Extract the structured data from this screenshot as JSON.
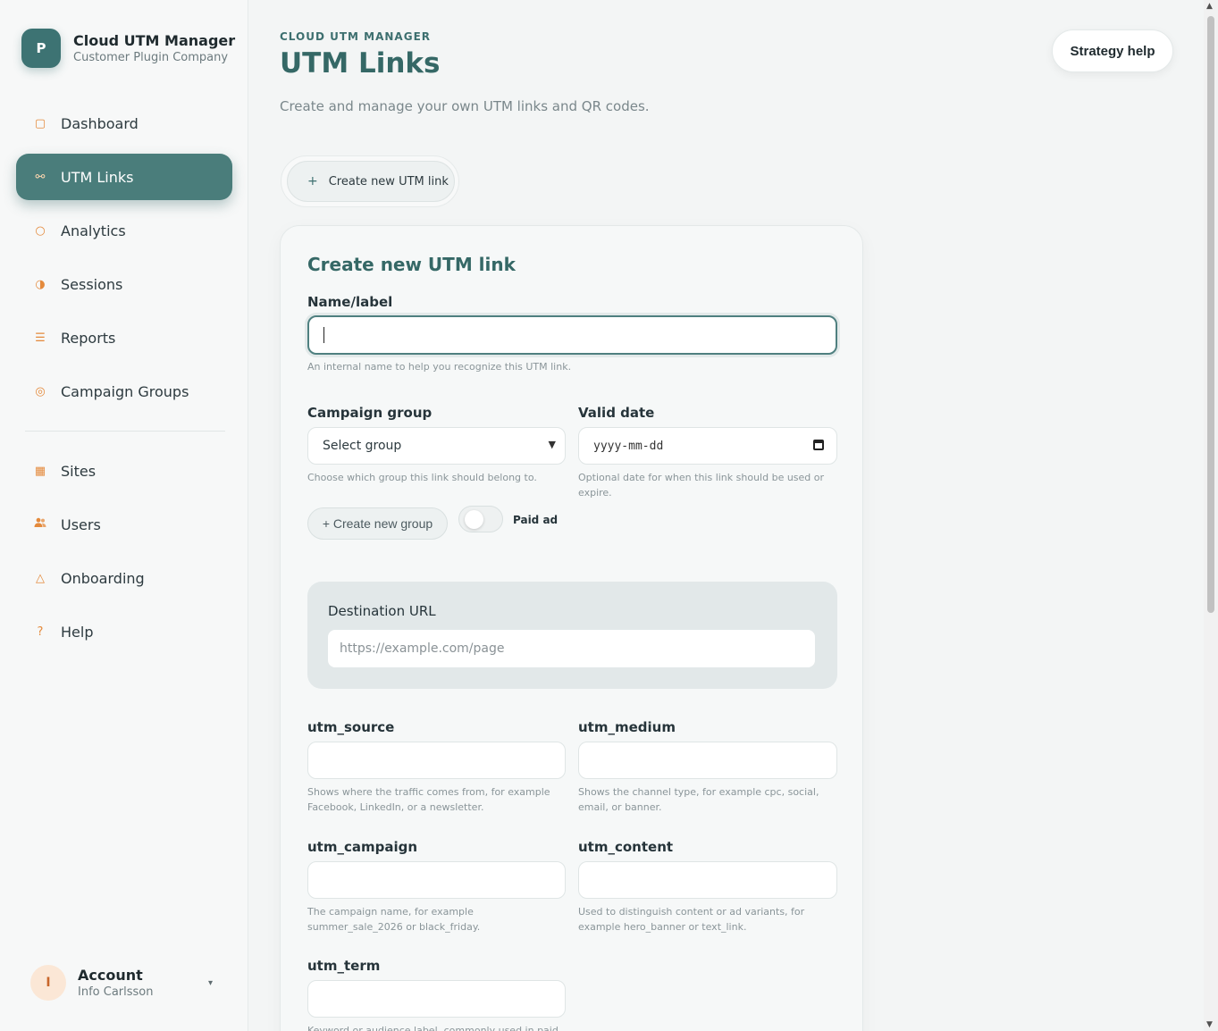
{
  "brand": {
    "logo_letter": "P",
    "title": "Cloud UTM Manager",
    "subtitle": "Customer Plugin Company"
  },
  "sidebar": {
    "items": [
      {
        "label": "Dashboard",
        "icon": "square-outline-icon",
        "glyph": "▢"
      },
      {
        "label": "UTM Links",
        "icon": "link-icon",
        "glyph": "⚯"
      },
      {
        "label": "Analytics",
        "icon": "circle-outline-icon",
        "glyph": "○"
      },
      {
        "label": "Sessions",
        "icon": "half-circle-icon",
        "glyph": "◑"
      },
      {
        "label": "Reports",
        "icon": "list-icon",
        "glyph": "☰"
      },
      {
        "label": "Campaign Groups",
        "icon": "target-icon",
        "glyph": "◎"
      },
      {
        "label": "Sites",
        "icon": "grid-icon",
        "glyph": "▦"
      },
      {
        "label": "Users",
        "icon": "users-icon",
        "glyph": "👥"
      },
      {
        "label": "Onboarding",
        "icon": "triangle-icon",
        "glyph": "△"
      },
      {
        "label": "Help",
        "icon": "question-icon",
        "glyph": "?"
      }
    ],
    "active": "UTM Links"
  },
  "account": {
    "initial": "I",
    "title": "Account",
    "subtitle": "Info Carlsson",
    "caret": "▾"
  },
  "header": {
    "eyebrow": "CLOUD UTM MANAGER",
    "title": "UTM Links",
    "description": "Create and manage your own UTM links and QR codes.",
    "help_label": "Strategy help"
  },
  "create_button": {
    "plus": "+",
    "label": "Create new UTM link"
  },
  "form": {
    "title": "Create new UTM link",
    "name": {
      "label": "Name/label",
      "value": "",
      "hint": "An internal name to help you recognize this UTM link."
    },
    "campaign_group": {
      "label": "Campaign group",
      "selected": "Select group",
      "hint": "Choose which group this link should belong to."
    },
    "valid_date": {
      "label": "Valid date",
      "placeholder": "yyyy-mm-dd",
      "hint": "Optional date for when this link should be used or expire."
    },
    "create_group_label": "+ Create new group",
    "paid_ad": {
      "label": "Paid ad",
      "on": false
    },
    "destination": {
      "label": "Destination URL",
      "placeholder": "https://example.com/page"
    },
    "utm_source": {
      "label": "utm_source",
      "hint": "Shows where the traffic comes from, for example Facebook, LinkedIn, or a newsletter."
    },
    "utm_medium": {
      "label": "utm_medium",
      "hint": "Shows the channel type, for example cpc, social, email, or banner."
    },
    "utm_campaign": {
      "label": "utm_campaign",
      "hint": "The campaign name, for example summer_sale_2026 or black_friday."
    },
    "utm_content": {
      "label": "utm_content",
      "hint": "Used to distinguish content or ad variants, for example hero_banner or text_link."
    },
    "utm_term": {
      "label": "utm_term",
      "hint": "Keyword or audience label, commonly used in paid"
    }
  },
  "colors": {
    "accent": "#4a7d7b",
    "brand": "#3d7373",
    "icon": "#e48a3c",
    "title": "#356866"
  }
}
